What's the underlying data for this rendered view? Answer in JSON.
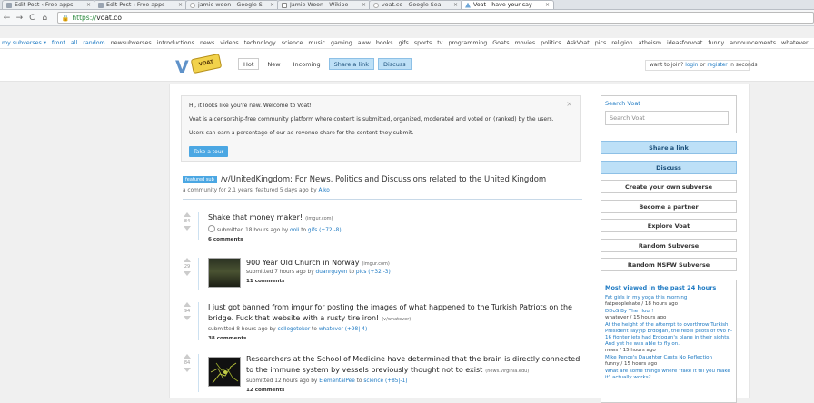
{
  "browser": {
    "tabs": [
      {
        "title": "Edit Post ‹ Free apps",
        "favicon": "page-icon"
      },
      {
        "title": "Edit Post ‹ Free apps",
        "favicon": "page-icon"
      },
      {
        "title": "jamie woon - Google S",
        "favicon": "google-icon"
      },
      {
        "title": "Jamie Woon - Wikipe",
        "favicon": "wikipedia-icon"
      },
      {
        "title": "voat.co - Google Sea",
        "favicon": "google-icon"
      },
      {
        "title": "Voat - have your say",
        "favicon": "voat-icon"
      }
    ],
    "url_protocol": "https://",
    "url_host": "voat.co"
  },
  "subverse_bar": {
    "items": [
      "my subverses ▾",
      "front",
      "all",
      "random",
      "newsubverses",
      "introductions",
      "news",
      "videos",
      "technology",
      "science",
      "music",
      "gaming",
      "aww",
      "books",
      "gifs",
      "sports",
      "tv",
      "programming",
      "Goats",
      "movies",
      "politics",
      "AskVoat",
      "pics",
      "religion",
      "atheism",
      "ideasforvoat",
      "funny",
      "announcements",
      "whatever",
      "IAMA"
    ]
  },
  "header": {
    "logo_text": "V",
    "logo_badge": "VOAT",
    "nav": [
      "Hot",
      "New",
      "Incoming",
      "Share a link",
      "Discuss"
    ],
    "join_prefix": "want to join?",
    "login": "login",
    "or": "or",
    "register": "register",
    "join_suffix": "in seconds"
  },
  "welcome": {
    "line1": "Hi, it looks like you're new. Welcome to Voat!",
    "line2": "Voat is a censorship-free community platform where content is submitted, organized, moderated and voted on (ranked) by the users.",
    "line3": "Users can earn a percentage of our ad-revenue share for the content they submit.",
    "button": "Take a tour",
    "close": "×"
  },
  "featured": {
    "badge": "featured sub",
    "title": "/v/UnitedKingdom: For News, Politics and Discussions related to the United Kingdom",
    "sub_prefix": "a community for 2.1 years, featured 5 days ago by",
    "sub_user": "Alko"
  },
  "posts": [
    {
      "score": "84",
      "title": "Shake that money maker!",
      "domain": "(imgur.com)",
      "meta_prefix": "submitted 18 hours ago by",
      "user": "ooli",
      "to": "to",
      "sub": "gifs",
      "votes": "(+72|-8)",
      "comments": "6 comments"
    },
    {
      "score": "29",
      "title": "900 Year Old Church in Norway",
      "domain": "(imgur.com)",
      "meta_prefix": "submitted 7 hours ago by",
      "user": "duanrguyen",
      "to": "to",
      "sub": "pics",
      "votes": "(+32|-3)",
      "comments": "11 comments"
    },
    {
      "score": "94",
      "title": "I just got banned from imgur for posting the images of what happened to the Turkish Patriots on the bridge. Fuck that website with a rusty tire iron!",
      "domain": "(v/whatever)",
      "meta_prefix": "submitted 8 hours ago by",
      "user": "collegetoker",
      "to": "to",
      "sub": "whatever",
      "votes": "(+98|-4)",
      "comments": "38 comments"
    },
    {
      "score": "84",
      "title": "Researchers at the School of Medicine have determined that the brain is directly connected to the immune system by vessels previously thought not to exist",
      "domain": "(news.virginia.edu)",
      "meta_prefix": "submitted 12 hours ago by",
      "user": "ElementalPee",
      "to": "to",
      "sub": "science",
      "votes": "(+85|-1)",
      "comments": "12 comments"
    }
  ],
  "sidebar": {
    "search_label": "Search Voat",
    "search_placeholder": "Search Voat",
    "buttons": [
      "Share a link",
      "Discuss",
      "Create your own subverse",
      "Become a partner",
      "Explore Voat",
      "Random Subverse",
      "Random NSFW Subverse"
    ],
    "most_viewed_label": "Most viewed in the past 24 hours",
    "most_viewed": [
      {
        "title": "Fat girls in my yoga this morning",
        "meta": "fatpeoplehate / 18 hours ago"
      },
      {
        "title": "DDoS By The Hour!",
        "meta": "whatever / 15 hours ago"
      },
      {
        "title": "At the height of the attempt to overthrow Turkish President Tayyip Erdogan, the rebel pilots of two F-16 fighter jets had Erdogan's plane in their sights. And yet he was able to fly on.",
        "meta": "news / 15 hours ago"
      },
      {
        "title": "Mike Pence's Daughter Casts No Reflection",
        "meta": "funny / 15 hours ago"
      },
      {
        "title": "What are some things where \"fake it till you make it\" actually works?",
        "meta": ""
      }
    ]
  },
  "colors": {
    "accent": "#4ba7e3",
    "link": "#1b78c2",
    "button_blue": "#bde0f7"
  }
}
